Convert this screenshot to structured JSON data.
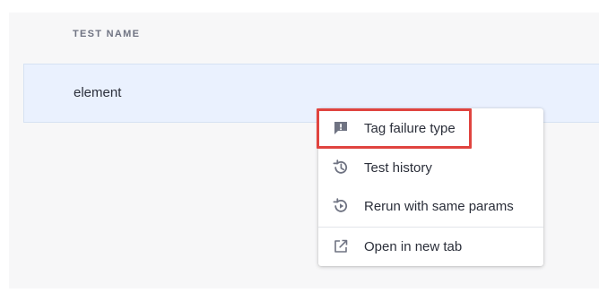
{
  "table": {
    "column_header": "TEST NAME",
    "rows": [
      {
        "name": "element"
      }
    ]
  },
  "context_menu": {
    "items": [
      {
        "label": "Tag failure type",
        "icon": "tag-failure-icon"
      },
      {
        "label": "Test history",
        "icon": "history-icon"
      },
      {
        "label": "Rerun with same params",
        "icon": "rerun-icon"
      },
      {
        "label": "Open in new tab",
        "icon": "external-link-icon"
      }
    ]
  },
  "colors": {
    "highlight_outline": "#e0443f",
    "selected_row_bg": "#eaf1fe",
    "icon_gray": "#6f7382"
  }
}
